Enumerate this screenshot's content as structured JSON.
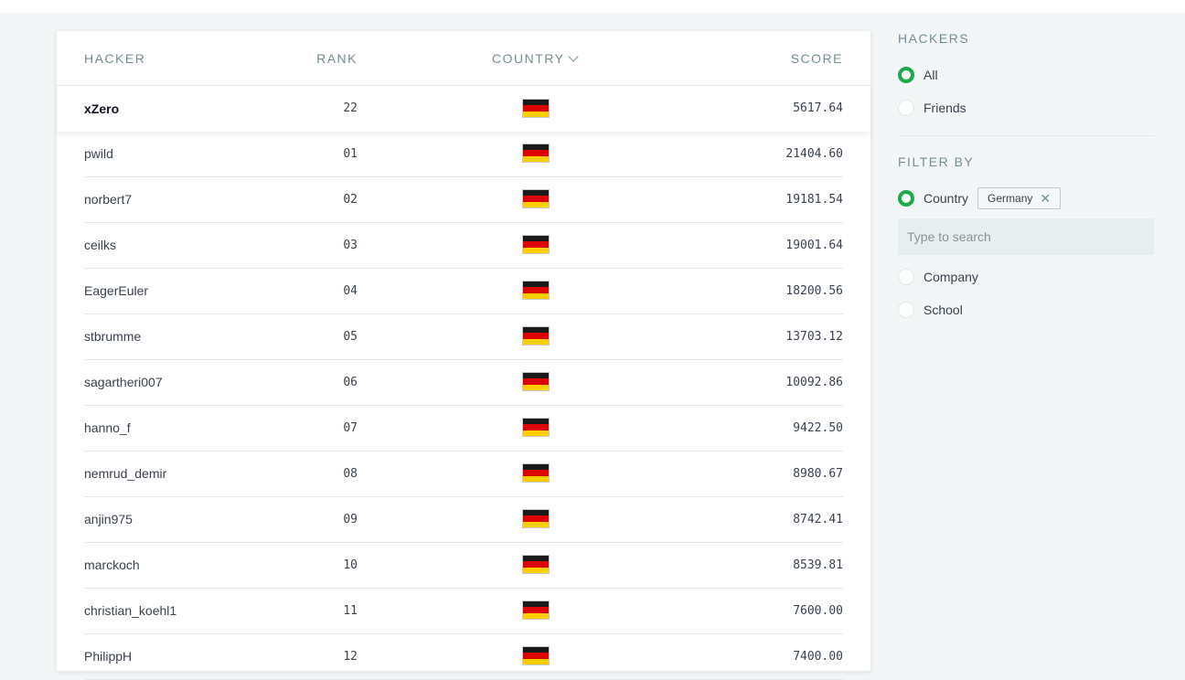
{
  "table": {
    "headers": {
      "hacker": "HACKER",
      "rank": "RANK",
      "country": "COUNTRY",
      "score": "SCORE"
    },
    "current_user": {
      "name": "xZero",
      "rank": "22",
      "country": "Germany",
      "score": "5617.64"
    },
    "rows": [
      {
        "name": "pwild",
        "rank": "01",
        "country": "Germany",
        "score": "21404.60"
      },
      {
        "name": "norbert7",
        "rank": "02",
        "country": "Germany",
        "score": "19181.54"
      },
      {
        "name": "ceilks",
        "rank": "03",
        "country": "Germany",
        "score": "19001.64"
      },
      {
        "name": "EagerEuler",
        "rank": "04",
        "country": "Germany",
        "score": "18200.56"
      },
      {
        "name": "stbrumme",
        "rank": "05",
        "country": "Germany",
        "score": "13703.12"
      },
      {
        "name": "sagartheri007",
        "rank": "06",
        "country": "Germany",
        "score": "10092.86"
      },
      {
        "name": "hanno_f",
        "rank": "07",
        "country": "Germany",
        "score": "9422.50"
      },
      {
        "name": "nemrud_demir",
        "rank": "08",
        "country": "Germany",
        "score": "8980.67"
      },
      {
        "name": "anjin975",
        "rank": "09",
        "country": "Germany",
        "score": "8742.41"
      },
      {
        "name": "marckoch",
        "rank": "10",
        "country": "Germany",
        "score": "8539.81"
      },
      {
        "name": "christian_koehl1",
        "rank": "11",
        "country": "Germany",
        "score": "7600.00"
      },
      {
        "name": "PhilippH",
        "rank": "12",
        "country": "Germany",
        "score": "7400.00"
      }
    ]
  },
  "flag_colors": [
    "#1a1a1a",
    "#dd0000",
    "#ffce00"
  ],
  "sidebar": {
    "hackers_title": "HACKERS",
    "hackers_options": [
      {
        "label": "All",
        "selected": true
      },
      {
        "label": "Friends",
        "selected": false
      }
    ],
    "filter_title": "FILTER BY",
    "country_label": "Country",
    "country_selected": true,
    "country_chip": "Germany",
    "search_placeholder": "Type to search",
    "other_filters": [
      {
        "label": "Company",
        "selected": false
      },
      {
        "label": "School",
        "selected": false
      }
    ]
  },
  "accent_color": "#1ba94c"
}
